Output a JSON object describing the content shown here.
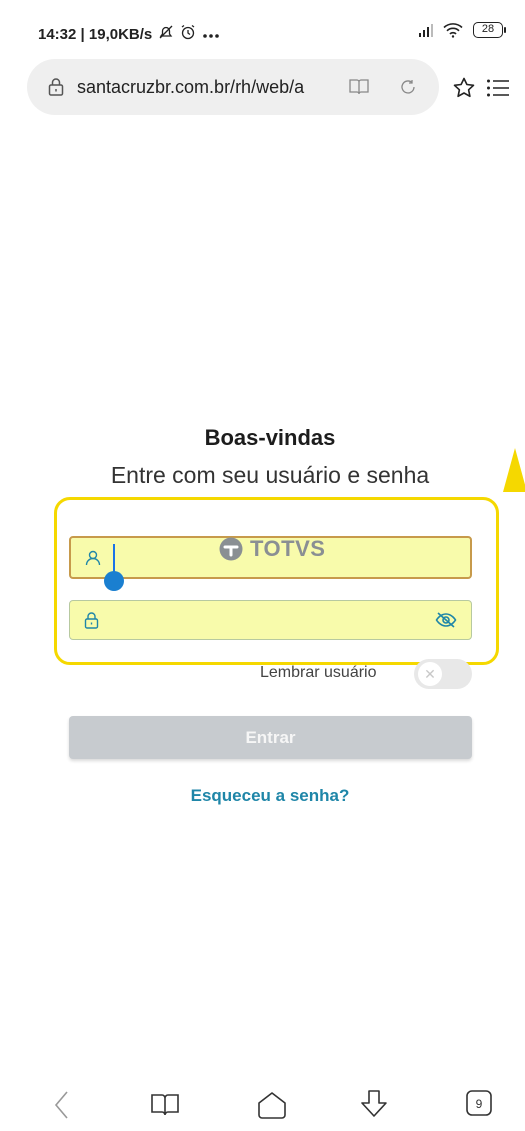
{
  "status_bar": {
    "time_speed": "14:32 | 19,0KB/s",
    "battery": "28",
    "icons": [
      "mute-notifications-icon",
      "alarm-icon",
      "more-dots-icon",
      "signal-icon",
      "wifi-icon",
      "battery-icon"
    ]
  },
  "browser": {
    "url": "santacruzbr.com.br/rh/web/a",
    "icons": [
      "lock-icon",
      "reader-mode-icon",
      "reload-icon",
      "star-icon",
      "menu-list-icon"
    ]
  },
  "login": {
    "title": "Boas-vindas",
    "subtitle": "Entre com seu usuário e senha",
    "username_value": "",
    "password_value": "",
    "remember_label": "Lembrar usuário",
    "remember_on": false,
    "enter_label": "Entrar",
    "forgot_label": "Esqueceu a senha?",
    "logo_text": "TOTVS"
  },
  "bottom_nav": {
    "tabs_count": "9",
    "icons": [
      "back-icon",
      "bookmarks-icon",
      "home-icon",
      "download-icon",
      "tabs-icon"
    ]
  },
  "colors": {
    "field_fill": "#f8fbab",
    "highlight": "#f5d800",
    "link": "#1f86a8",
    "button_disabled": "#c7cbcf",
    "icon_teal": "#1f86a8"
  }
}
